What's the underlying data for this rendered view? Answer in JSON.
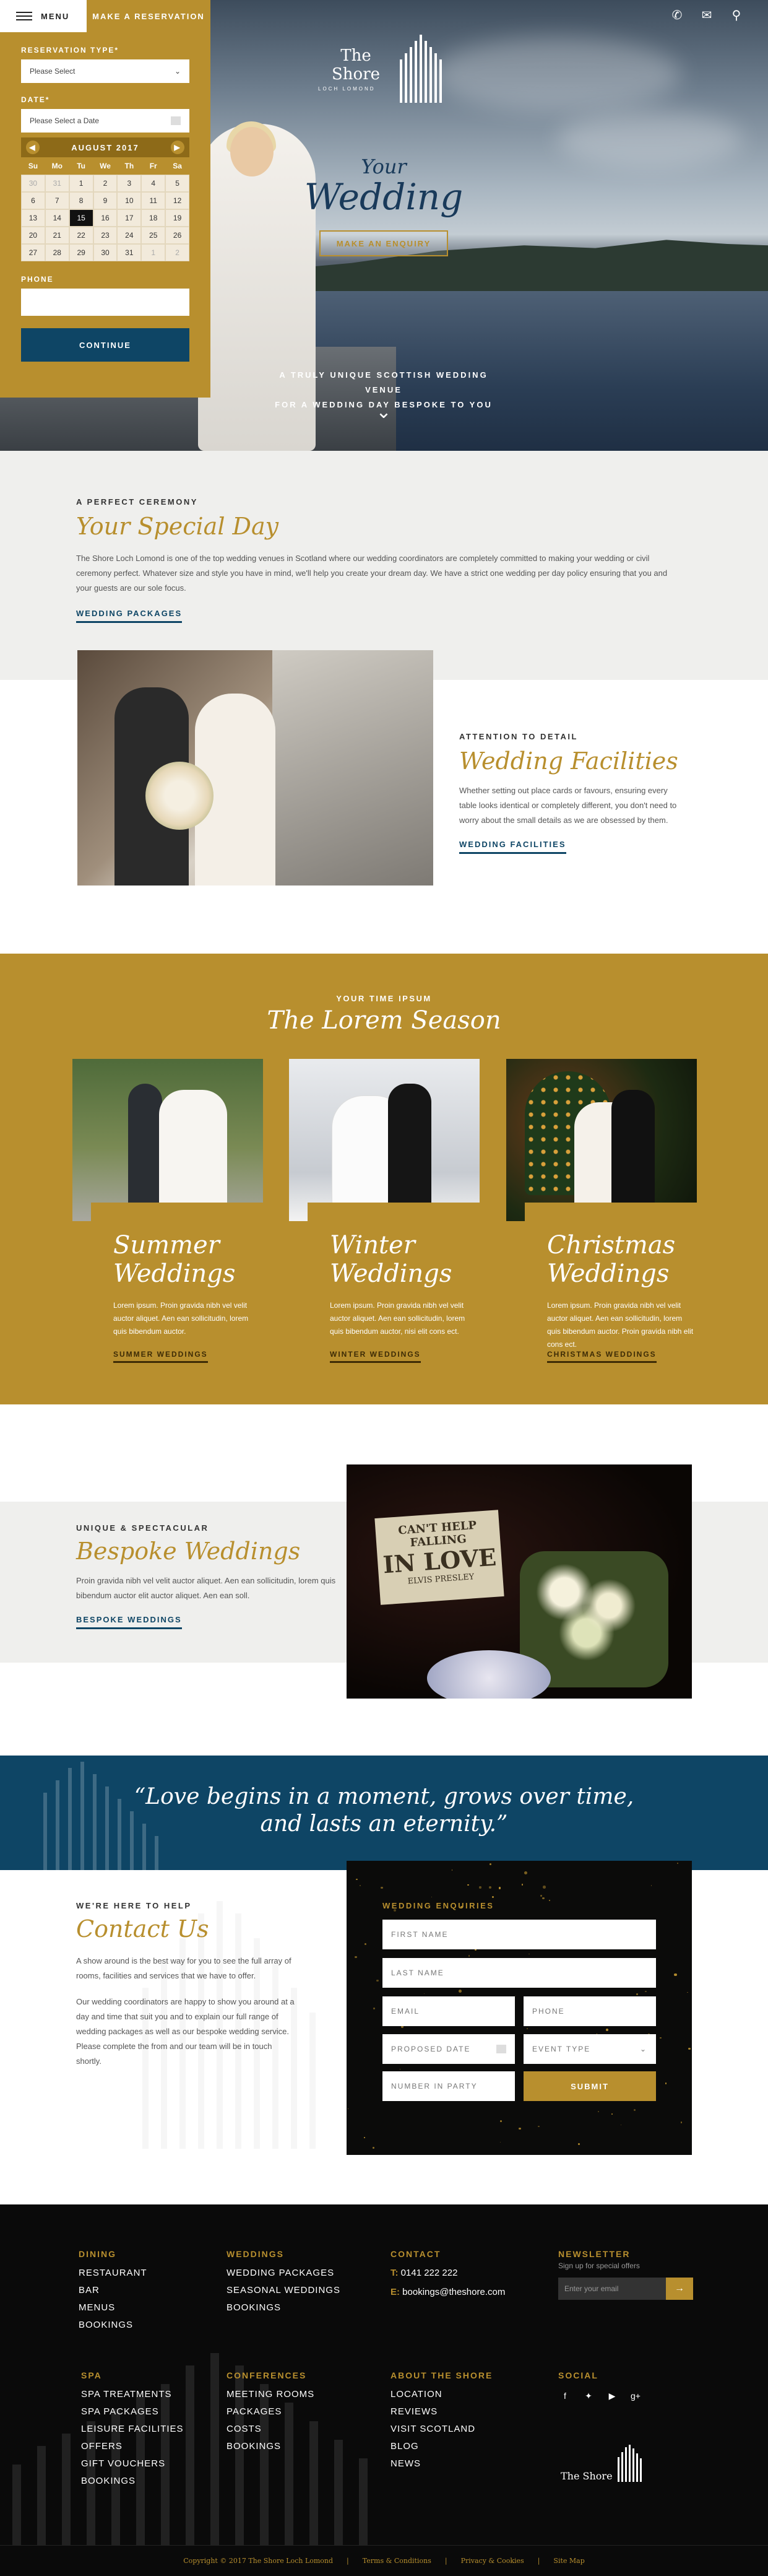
{
  "topbar": {
    "menu_label": "MENU",
    "reserve_label": "MAKE A RESERVATION",
    "icons": [
      "phone-icon",
      "mail-icon",
      "location-pin-icon"
    ]
  },
  "reservation": {
    "type_label": "RESERVATION TYPE*",
    "type_value": "Please Select",
    "date_label": "DATE*",
    "date_placeholder": "Please Select a Date",
    "calendar": {
      "month": "AUGUST 2017",
      "weekdays": [
        "Su",
        "Mo",
        "Tu",
        "We",
        "Th",
        "Fr",
        "Sa"
      ],
      "weeks": [
        [
          "30",
          "31",
          "1",
          "2",
          "3",
          "4",
          "5"
        ],
        [
          "6",
          "7",
          "8",
          "9",
          "10",
          "11",
          "12"
        ],
        [
          "13",
          "14",
          "15",
          "16",
          "17",
          "18",
          "19"
        ],
        [
          "20",
          "21",
          "22",
          "23",
          "24",
          "25",
          "26"
        ],
        [
          "27",
          "28",
          "29",
          "30",
          "31",
          "1",
          "2"
        ]
      ],
      "selected": "15"
    },
    "phone_label": "PHONE",
    "continue_label": "CONTINUE"
  },
  "hero": {
    "logo_name": "The Shore",
    "logo_sub": "LOCH LOMOND",
    "your": "Your",
    "wedding": "Wedding",
    "enquiry_label": "MAKE AN ENQUIRY",
    "tagline_1": "A TRULY UNIQUE SCOTTISH WEDDING VENUE",
    "tagline_2": "FOR A WEDDING DAY BESPOKE TO YOU"
  },
  "special_day": {
    "eyebrow": "A PERFECT CEREMONY",
    "title": "Your Special Day",
    "body": "The Shore Loch Lomond is one of the top wedding venues in Scotland where our wedding coordinators are completely committed to making your wedding or civil ceremony perfect. Whatever size and style you have in mind, we'll help you create your dream day. We have a strict one wedding per day policy ensuring that you and your guests are our sole focus.",
    "link": "WEDDING PACKAGES"
  },
  "facilities": {
    "eyebrow": "ATTENTION TO DETAIL",
    "title": "Wedding Facilities",
    "body": "Whether setting out place cards or favours, ensuring every table looks identical or completely different, you don't need to worry about the small details as we are obsessed by them.",
    "link": "WEDDING FACILITIES"
  },
  "season": {
    "eyebrow": "YOUR TIME IPSUM",
    "title": "The Lorem Season",
    "cards": [
      {
        "title_1": "Summer",
        "title_2": "Weddings",
        "body": "Lorem ipsum. Proin gravida nibh vel velit auctor aliquet. Aen ean sollicitudin, lorem quis bibendum auctor.",
        "link": "SUMMER WEDDINGS"
      },
      {
        "title_1": "Winter",
        "title_2": "Weddings",
        "body": "Lorem ipsum. Proin gravida nibh vel velit auctor aliquet. Aen ean sollicitudin, lorem quis bibendum auctor, nisi elit cons ect.",
        "link": "WINTER WEDDINGS"
      },
      {
        "title_1": "Christmas",
        "title_2": "Weddings",
        "body": "Lorem ipsum. Proin gravida nibh vel velit auctor aliquet. Aen ean sollicitudin, lorem quis bibendum auctor. Proin gravida nibh elit cons ect.",
        "link": "CHRISTMAS WEDDINGS"
      }
    ]
  },
  "bespoke": {
    "eyebrow": "UNIQUE & SPECTACULAR",
    "title": "Bespoke Weddings",
    "body": "Proin gravida nibh vel velit auctor aliquet. Aen ean sollicitudin, lorem quis bibendum auctor elit auctor aliquet. Aen ean soll.",
    "link": "BESPOKE WEDDINGS",
    "sign_1": "CAN'T HELP FALLING",
    "sign_2": "IN LOVE",
    "sign_3": "ELVIS PRESLEY"
  },
  "quote": {
    "line_1": "“Love begins in a moment, grows over time,",
    "line_2": "and lasts an eternity.”"
  },
  "contact": {
    "eyebrow": "WE'RE HERE TO HELP",
    "title": "Contact Us",
    "body_1": "A show around is the best way for you to see the full array of rooms, facilities and services that we have to offer.",
    "body_2": "Our wedding coordinators are happy to show you around at a day and time that suit you and to explain our full range of wedding packages as well as our bespoke wedding service. Please complete the from and our team will be in touch shortly."
  },
  "form": {
    "title": "WEDDING ENQUIRIES",
    "first_name": "FIRST NAME",
    "last_name": "LAST NAME",
    "email": "EMAIL",
    "phone": "PHONE",
    "proposed_date": "PROPOSED DATE",
    "event_type": "EVENT TYPE",
    "number_in_party": "NUMBER IN PARTY",
    "submit": "SUBMIT"
  },
  "footer": {
    "dining": {
      "head": "DINING",
      "items": [
        "RESTAURANT",
        "BAR",
        "MENUS",
        "BOOKINGS"
      ]
    },
    "weddings": {
      "head": "WEDDINGS",
      "items": [
        "WEDDING PACKAGES",
        "SEASONAL WEDDINGS",
        "BOOKINGS"
      ]
    },
    "contact": {
      "head": "CONTACT",
      "phone_prefix": "T:",
      "phone": "0141 222 222",
      "email_prefix": "E:",
      "email": "bookings@theshore.com"
    },
    "newsletter": {
      "head": "NEWSLETTER",
      "sub": "Sign up for special offers",
      "placeholder": "Enter your email"
    },
    "spa": {
      "head": "SPA",
      "items": [
        "SPA TREATMENTS",
        "SPA PACKAGES",
        "LEISURE FACILITIES",
        "OFFERS",
        "GIFT VOUCHERS",
        "BOOKINGS"
      ]
    },
    "conferences": {
      "head": "CONFERENCES",
      "items": [
        "MEETING ROOMS",
        "PACKAGES",
        "COSTS",
        "BOOKINGS"
      ]
    },
    "about": {
      "head": "ABOUT THE SHORE",
      "items": [
        "LOCATION",
        "REVIEWS",
        "VISIT SCOTLAND",
        "BLOG",
        "NEWS"
      ]
    },
    "social": {
      "head": "SOCIAL",
      "icons": [
        "facebook-icon",
        "twitter-icon",
        "youtube-icon",
        "google-plus-icon"
      ]
    },
    "logo_name": "The Shore",
    "copyright": "Copyright © 2017 The Shore Loch Lomond",
    "terms": "Terms & Conditions",
    "privacy": "Privacy & Cookies",
    "sitemap": "Site Map"
  },
  "colors": {
    "gold": "#b88f2e",
    "navy": "#0e4565",
    "black": "#0a0a0a",
    "grey": "#efefed"
  }
}
